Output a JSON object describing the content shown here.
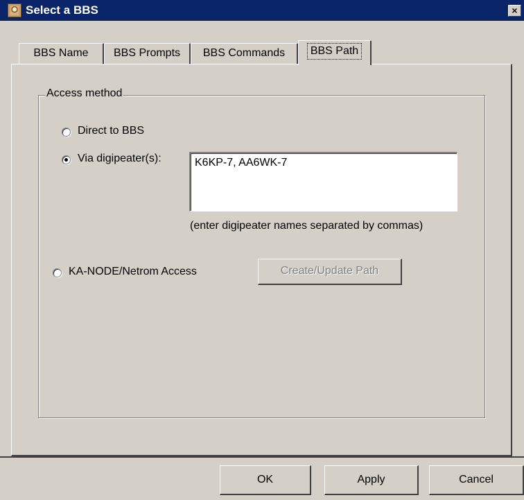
{
  "window": {
    "title": "Select a BBS",
    "close_label": "×"
  },
  "tabs": [
    {
      "label": "BBS Name"
    },
    {
      "label": "BBS Prompts"
    },
    {
      "label": "BBS Commands"
    },
    {
      "label": "BBS Path",
      "active": true
    }
  ],
  "access": {
    "group_label": "Access method",
    "direct_label": "Direct to BBS",
    "via_label": "Via digipeater(s):",
    "digipeater_value": "K6KP-7, AA6WK-7",
    "digipeater_hint": "(enter digipeater names separated by commas)",
    "kanode_label": "KA-NODE/Netrom Access",
    "create_path_label": "Create/Update Path",
    "selected": "via"
  },
  "footer": {
    "ok_label": "OK",
    "apply_label": "Apply",
    "cancel_label": "Cancel"
  }
}
